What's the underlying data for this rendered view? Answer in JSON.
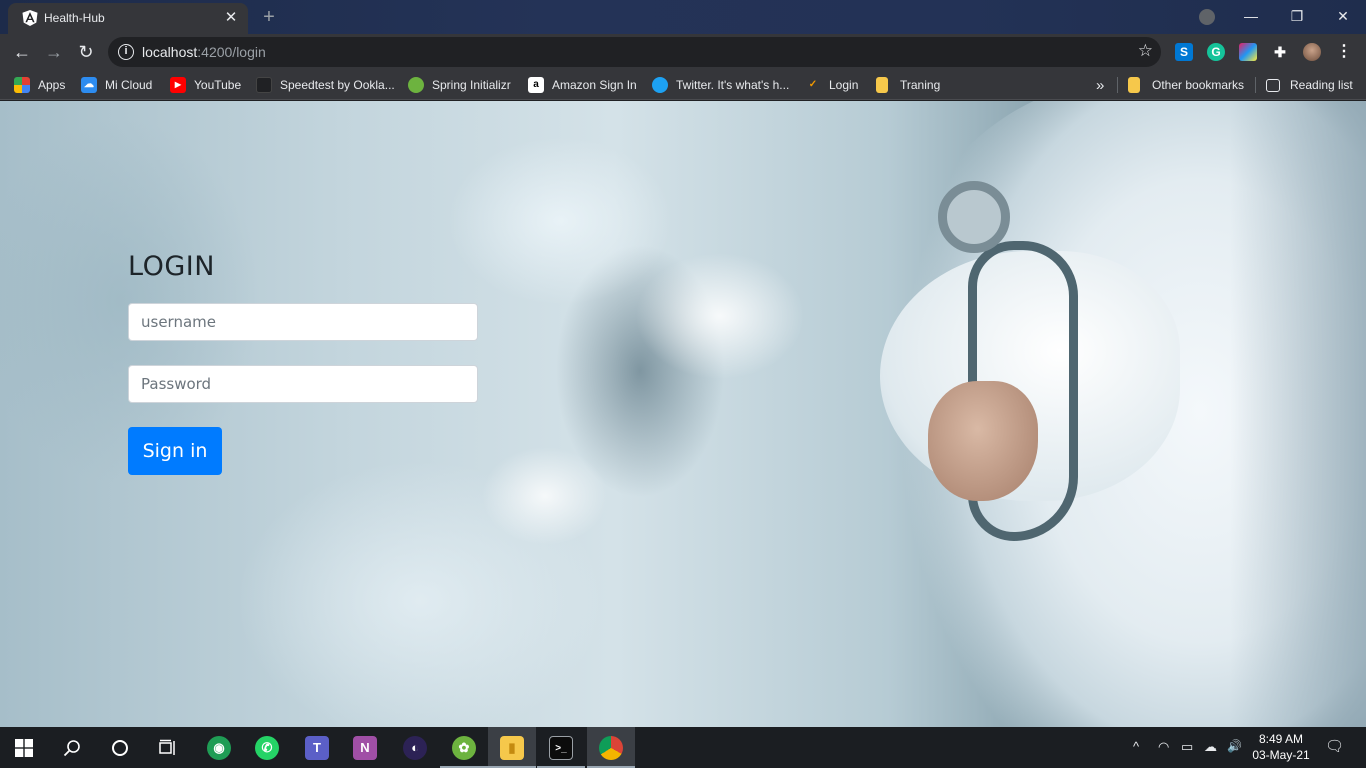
{
  "browser": {
    "tab": {
      "title": "Health-Hub",
      "close": "✕"
    },
    "new_tab": "+",
    "window": {
      "minimize": "—",
      "restore": "❐",
      "close": "✕"
    },
    "nav": {
      "back": "←",
      "forward": "→",
      "reload": "↻"
    },
    "address": {
      "host": "localhost",
      "path": ":4200/login",
      "info": "i",
      "star": "☆"
    },
    "extensions": [
      {
        "icon": "skype-icon",
        "glyph": "S",
        "color": "#0078d4"
      },
      {
        "icon": "grammarly-icon",
        "glyph": "G",
        "color": "#15c39a"
      },
      {
        "icon": "color-picker-icon",
        "glyph": "◆",
        "color": "#e91e63"
      },
      {
        "icon": "puzzle-icon",
        "glyph": "✚",
        "color": "#35363a"
      },
      {
        "icon": "avatar",
        "glyph": "",
        "color": "#8a6a55"
      },
      {
        "icon": "menu-icon",
        "glyph": "⋮",
        "color": "#35363a"
      }
    ],
    "bookmarks": {
      "items": [
        {
          "label": "Apps",
          "icon": "apps-grid-icon",
          "color": "#e34133",
          "glyph": "⋮"
        },
        {
          "label": "Mi Cloud",
          "icon": "mi-cloud-icon",
          "color": "#2d8cf0",
          "glyph": "☁"
        },
        {
          "label": "YouTube",
          "icon": "youtube-icon",
          "color": "#ff0000",
          "glyph": "▶"
        },
        {
          "label": "Speedtest by Ookla...",
          "icon": "speedtest-icon",
          "color": "#202124",
          "glyph": "◔"
        },
        {
          "label": "Spring Initializr",
          "icon": "spring-icon",
          "color": "#6db33f",
          "glyph": "✿"
        },
        {
          "label": "Amazon Sign In",
          "icon": "amazon-icon",
          "color": "#ffffff",
          "glyph": "a"
        },
        {
          "label": "Twitter. It's what's h...",
          "icon": "twitter-icon",
          "color": "#1da1f2",
          "glyph": "🐦"
        },
        {
          "label": "Login",
          "icon": "login-icon",
          "color": "#35363a",
          "glyph": "✓"
        },
        {
          "label": "Traning",
          "icon": "folder-icon",
          "color": "#f6c84b",
          "glyph": ""
        }
      ],
      "overflow": "»",
      "other": "Other bookmarks",
      "reading_list": "Reading list"
    }
  },
  "page": {
    "title": "LOGIN",
    "username_placeholder": "username",
    "password_placeholder": "Password",
    "signin_label": "Sign in",
    "colors": {
      "primary": "#007bff"
    }
  },
  "taskbar": {
    "apps": [
      {
        "name": "start-button",
        "icon": "windows-icon",
        "glyph": "⊞",
        "color": "transparent"
      },
      {
        "name": "search-button",
        "icon": "search-icon",
        "glyph": "⌕",
        "color": "transparent"
      },
      {
        "name": "cortana-button",
        "icon": "cortana-icon",
        "glyph": "○",
        "color": "transparent"
      },
      {
        "name": "task-view-button",
        "icon": "task-view-icon",
        "glyph": "▭",
        "color": "transparent"
      },
      {
        "name": "maps-app",
        "icon": "location-icon",
        "glyph": "◉",
        "color": "#1f9d55"
      },
      {
        "name": "whatsapp-app",
        "icon": "whatsapp-icon",
        "glyph": "✆",
        "color": "#25d366"
      },
      {
        "name": "teams-app",
        "icon": "teams-icon",
        "glyph": "T",
        "color": "#5b5fc7"
      },
      {
        "name": "onenote-app",
        "icon": "onenote-icon",
        "glyph": "N",
        "color": "#a04fa6"
      },
      {
        "name": "eclipse-app",
        "icon": "eclipse-icon",
        "glyph": "◐",
        "color": "#2c2255"
      },
      {
        "name": "spring-tool-app",
        "icon": "spring-icon",
        "glyph": "✿",
        "color": "#6db33f"
      },
      {
        "name": "file-explorer-app",
        "icon": "folder-icon",
        "glyph": "▮",
        "color": "#f6c84b"
      },
      {
        "name": "terminal-app",
        "icon": "terminal-icon",
        "glyph": ">_",
        "color": "#0c0c0c"
      },
      {
        "name": "chrome-app",
        "icon": "chrome-icon",
        "glyph": "◎",
        "color": "#db4437"
      }
    ],
    "tray": {
      "chevron": "^",
      "wifi": "◠",
      "battery": "▭",
      "cloud": "☁",
      "volume": "🔊",
      "notifications": "🗨"
    },
    "time": "8:49 AM",
    "date": "03-May-21"
  }
}
